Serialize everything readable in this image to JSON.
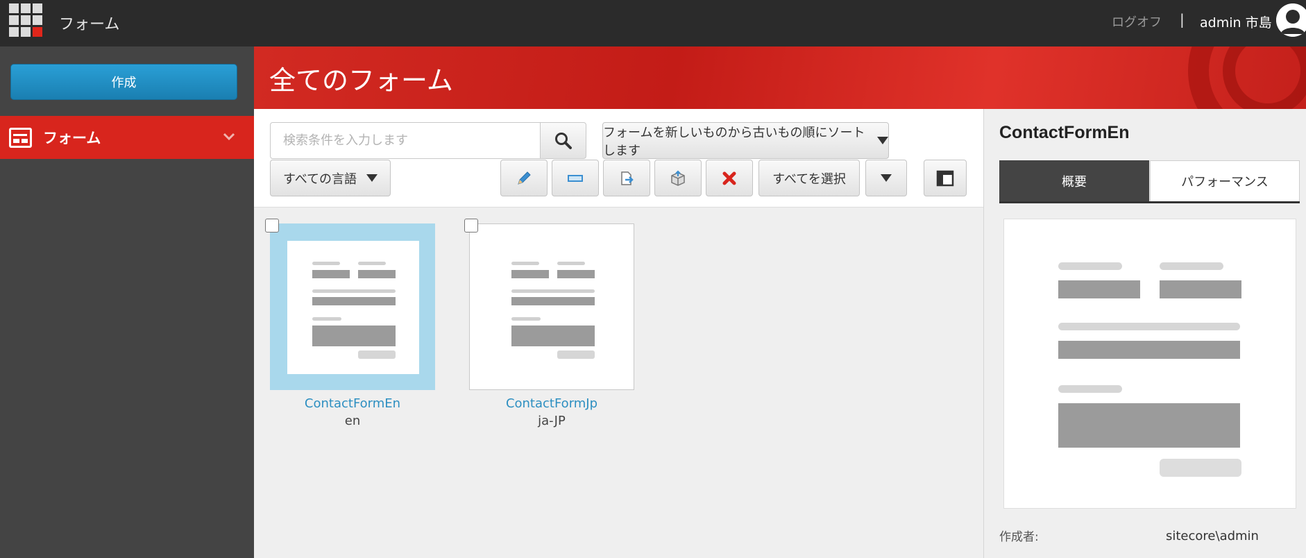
{
  "topbar": {
    "app_title": "フォーム",
    "logout": "ログオフ",
    "separator": "|",
    "username": "admin 市島"
  },
  "sidebar": {
    "create_label": "作成",
    "nav_forms_label": "フォーム"
  },
  "header": {
    "title": "全てのフォーム"
  },
  "toolbar": {
    "search_placeholder": "検索条件を入力します",
    "sort_label": "フォームを新しいものから古いもの順にソートします",
    "language_label": "すべての言語",
    "select_all_label": "すべてを選択"
  },
  "forms": [
    {
      "name": "ContactFormEn",
      "language": "en",
      "selected": true
    },
    {
      "name": "ContactFormJp",
      "language": "ja-JP",
      "selected": false
    }
  ],
  "details": {
    "title": "ContactFormEn",
    "tabs": [
      "概要",
      "パフォーマンス"
    ],
    "author_label": "作成者:",
    "author_value": "sitecore\\admin"
  },
  "colors": {
    "accent_red": "#d8251d",
    "primary_blue": "#1a8ac4",
    "selected_card": "#a9d8ec",
    "sidebar_bg": "#444444"
  },
  "icons": [
    "app-launcher-icon",
    "user-avatar-icon",
    "forms-nav-icon",
    "chevron-down-icon",
    "search-icon",
    "dropdown-caret-icon",
    "edit-pencil-icon",
    "rename-field-icon",
    "export-icon",
    "deploy-box-icon",
    "delete-x-icon",
    "layout-panel-icon"
  ]
}
